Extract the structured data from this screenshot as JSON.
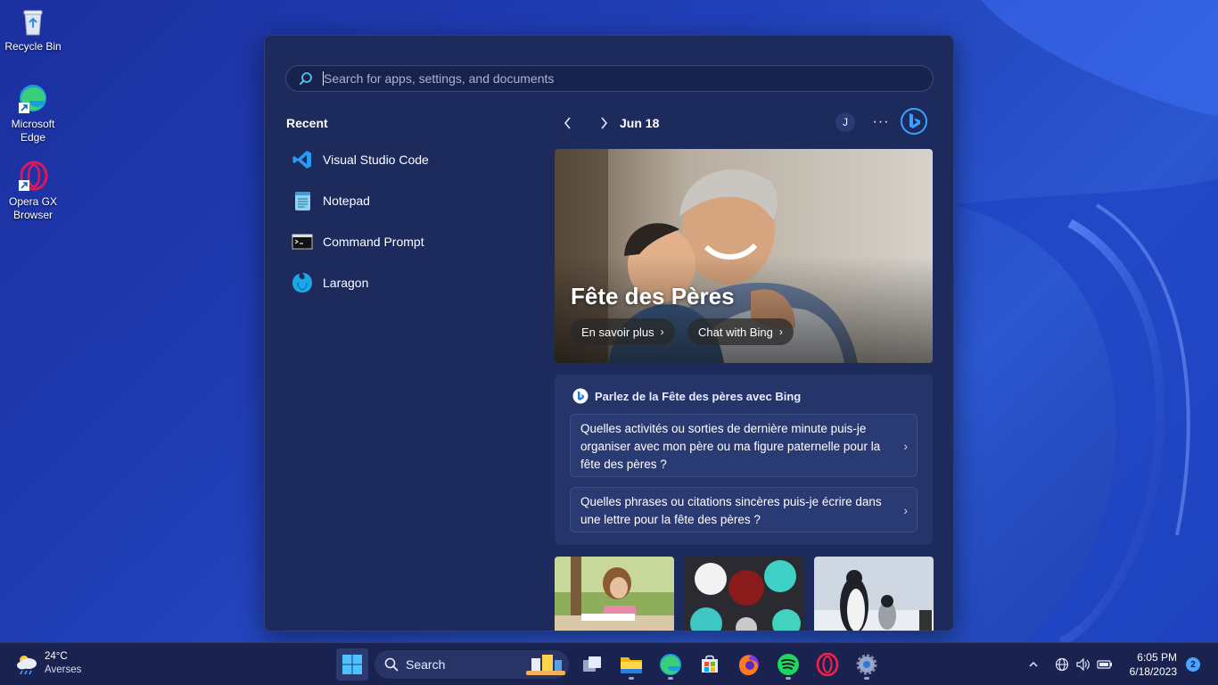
{
  "desktop": {
    "icons": [
      {
        "label": "Recycle Bin"
      },
      {
        "label": "Microsoft Edge"
      },
      {
        "label": "Opera GX Browser"
      }
    ]
  },
  "search_panel": {
    "search_placeholder": "Search for apps, settings, and documents",
    "recent_title": "Recent",
    "recent": [
      {
        "label": "Visual Studio Code",
        "icon": "vscode-icon"
      },
      {
        "label": "Notepad",
        "icon": "notepad-icon"
      },
      {
        "label": "Command Prompt",
        "icon": "command-prompt-icon"
      },
      {
        "label": "Laragon",
        "icon": "laragon-icon"
      }
    ],
    "date": "Jun 18",
    "avatar_initial": "J",
    "more_label": "···",
    "hero": {
      "title": "Fête des Pères",
      "buttons": [
        "En savoir plus",
        "Chat with Bing"
      ]
    },
    "bing_card": {
      "title": "Parlez de la Fête des pères avec Bing",
      "prompts": [
        "Quelles activités ou sorties de dernière minute puis-je organiser avec mon père ou ma figure paternelle pour la fête des pères ?",
        "Quelles phrases ou citations sincères puis-je écrire dans une lettre pour la fête des pères ?"
      ]
    }
  },
  "taskbar": {
    "weather": {
      "temp": "24°C",
      "condition": "Averses"
    },
    "search_label": "Search",
    "clock": {
      "time": "6:05 PM",
      "date": "6/18/2023"
    },
    "notification_count": "2"
  },
  "colors": {
    "accent": "#4aa3ff",
    "panel_bg": "#1c2a5c",
    "taskbar_bg": "#1a2350"
  }
}
